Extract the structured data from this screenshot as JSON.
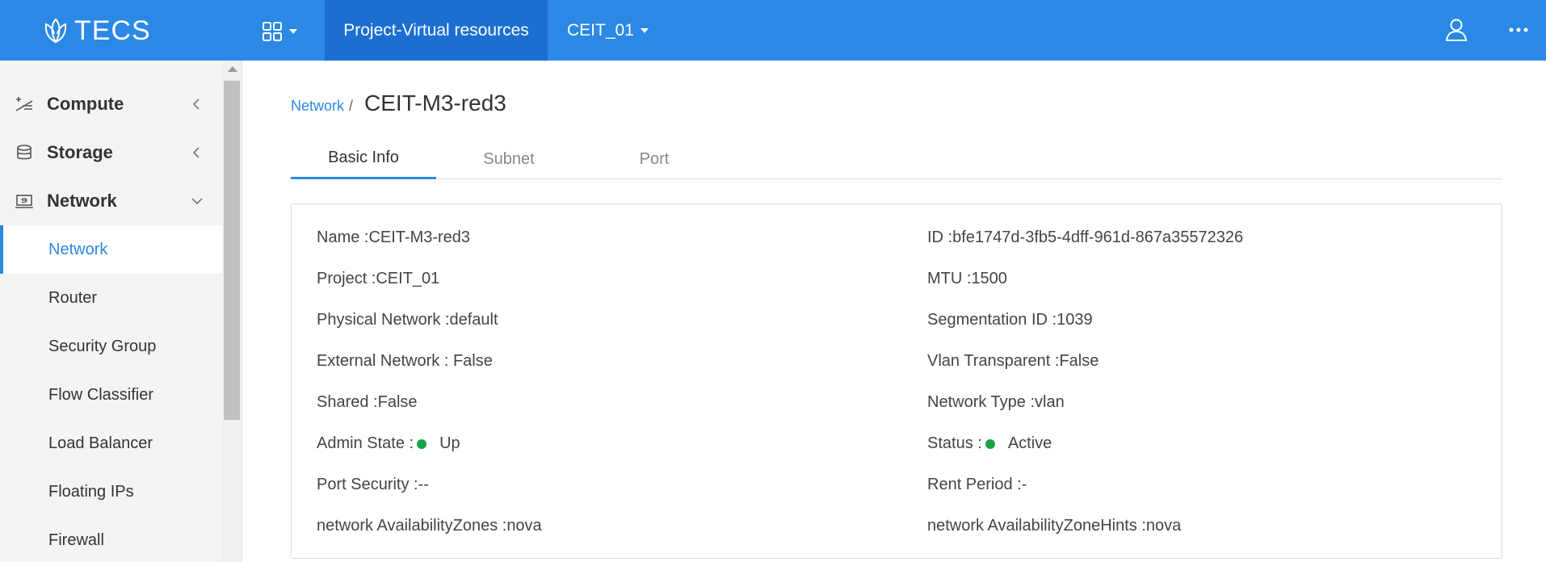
{
  "header": {
    "logo_text": "TECS",
    "nav_tab": "Project-Virtual resources",
    "project_select": "CEIT_01"
  },
  "sidebar": {
    "groups": [
      {
        "label": "Compute",
        "icon": "compute-icon",
        "expanded": false
      },
      {
        "label": "Storage",
        "icon": "storage-icon",
        "expanded": false
      },
      {
        "label": "Network",
        "icon": "network-icon",
        "expanded": true
      }
    ],
    "network_items": [
      {
        "label": "Network",
        "active": true
      },
      {
        "label": "Router"
      },
      {
        "label": "Security Group"
      },
      {
        "label": "Flow Classifier"
      },
      {
        "label": "Load Balancer"
      },
      {
        "label": "Floating IPs"
      },
      {
        "label": "Firewall"
      }
    ]
  },
  "breadcrumb": {
    "parent": "Network",
    "separator": "/",
    "title": "CEIT-M3-red3"
  },
  "tabs": [
    {
      "label": "Basic Info",
      "active": true
    },
    {
      "label": "Subnet"
    },
    {
      "label": "Port"
    }
  ],
  "basic_info": {
    "left": [
      {
        "label": "Name :",
        "value": "CEIT-M3-red3"
      },
      {
        "label": "Project :",
        "value": "CEIT_01"
      },
      {
        "label": "Physical Network :",
        "value": "default"
      },
      {
        "label": "External Network : ",
        "value": "False"
      },
      {
        "label": "Shared :",
        "value": "False"
      },
      {
        "label": "Admin State :",
        "value": "Up",
        "status_dot": true
      },
      {
        "label": "Port Security :",
        "value": "--"
      },
      {
        "label": "network AvailabilityZones :",
        "value": "nova"
      }
    ],
    "right": [
      {
        "label": "ID :",
        "value": "bfe1747d-3fb5-4dff-961d-867a35572326"
      },
      {
        "label": "MTU :",
        "value": "1500"
      },
      {
        "label": "Segmentation ID :",
        "value": "1039"
      },
      {
        "label": "Vlan Transparent :",
        "value": "False"
      },
      {
        "label": "Network Type :",
        "value": "vlan"
      },
      {
        "label": "Status :",
        "value": "Active",
        "status_dot": true
      },
      {
        "label": "Rent Period :",
        "value": "-"
      },
      {
        "label": "network AvailabilityZoneHints :",
        "value": "nova"
      }
    ]
  },
  "colors": {
    "primary": "#2b88e4",
    "primary_dark": "#1c6fd0",
    "status_green": "#1aa34a"
  }
}
